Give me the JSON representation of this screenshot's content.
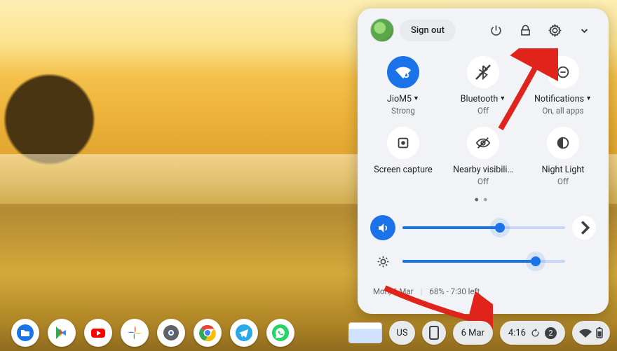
{
  "header": {
    "signout_label": "Sign out"
  },
  "tiles": {
    "wifi": {
      "label": "JioM5",
      "sub": "Strong",
      "has_caret": true,
      "on": true
    },
    "bluetooth": {
      "label": "Bluetooth",
      "sub": "Off",
      "has_caret": true,
      "on": false
    },
    "notif": {
      "label": "Notifications",
      "sub": "On, all apps",
      "has_caret": true,
      "on": false
    },
    "capture": {
      "label": "Screen capture",
      "sub": "",
      "has_caret": false,
      "on": false
    },
    "nearby": {
      "label": "Nearby visibili…",
      "sub": "Off",
      "has_caret": false,
      "on": false
    },
    "nightlight": {
      "label": "Night Light",
      "sub": "Off",
      "has_caret": false,
      "on": false
    }
  },
  "sliders": {
    "volume_pct": 60,
    "brightness_pct": 82
  },
  "footer": {
    "date": "Mon, 6 Mar",
    "battery": "68% - 7:30 left"
  },
  "shelf": {
    "ime": "US",
    "date_short": "6 Mar",
    "clock": "4:16",
    "notif_count": "2"
  }
}
